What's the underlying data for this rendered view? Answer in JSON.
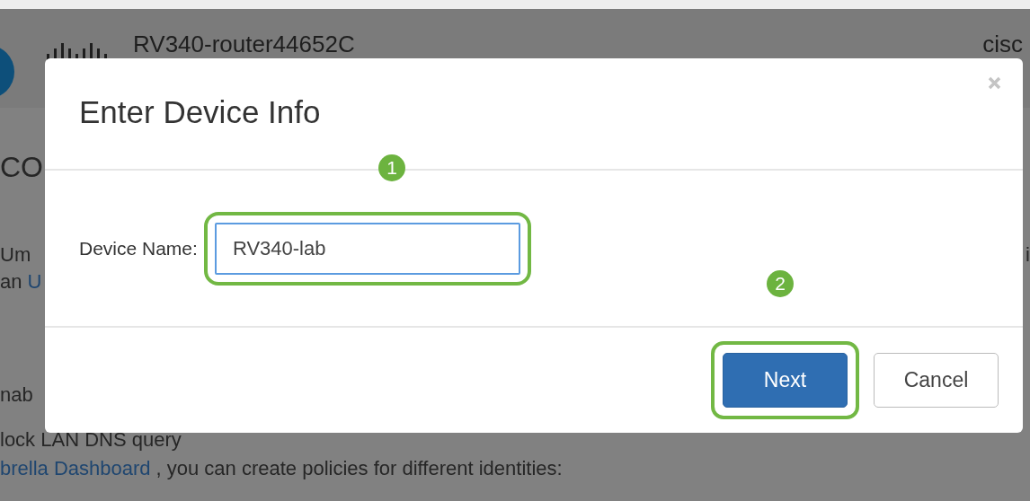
{
  "background_page": {
    "header": {
      "device_name": "RV340-router44652C",
      "brand": "cisc"
    },
    "lines": [
      {
        "left": [
          {
            "text": "CO",
            "kind": "heading"
          }
        ]
      },
      {
        "left": [
          {
            "text": "Um",
            "kind": "text"
          }
        ],
        "right": [
          {
            "text": "i",
            "kind": "text"
          }
        ]
      },
      {
        "left": [
          {
            "text": "an",
            "kind": "text"
          },
          {
            "text": "U",
            "kind": "link"
          }
        ]
      },
      {
        "left": [
          {
            "text": "nab",
            "kind": "text"
          }
        ]
      },
      {
        "left": [
          {
            "text": "lock LAN DNS query",
            "kind": "text"
          }
        ]
      },
      {
        "left": [
          {
            "text": "brella Dashboard",
            "kind": "link"
          },
          {
            "text": ", you can create policies for different identities:",
            "kind": "text"
          }
        ]
      }
    ]
  },
  "dialog": {
    "title": "Enter Device Info",
    "field": {
      "label": "Device Name:",
      "value": "RV340-lab",
      "focused": true,
      "highlighted": true
    },
    "buttons": [
      {
        "label": "Next",
        "kind": "primary",
        "highlighted": true
      },
      {
        "label": "Cancel",
        "kind": "secondary",
        "highlighted": false
      }
    ],
    "callouts": [
      {
        "number": "1"
      },
      {
        "number": "2"
      }
    ]
  }
}
